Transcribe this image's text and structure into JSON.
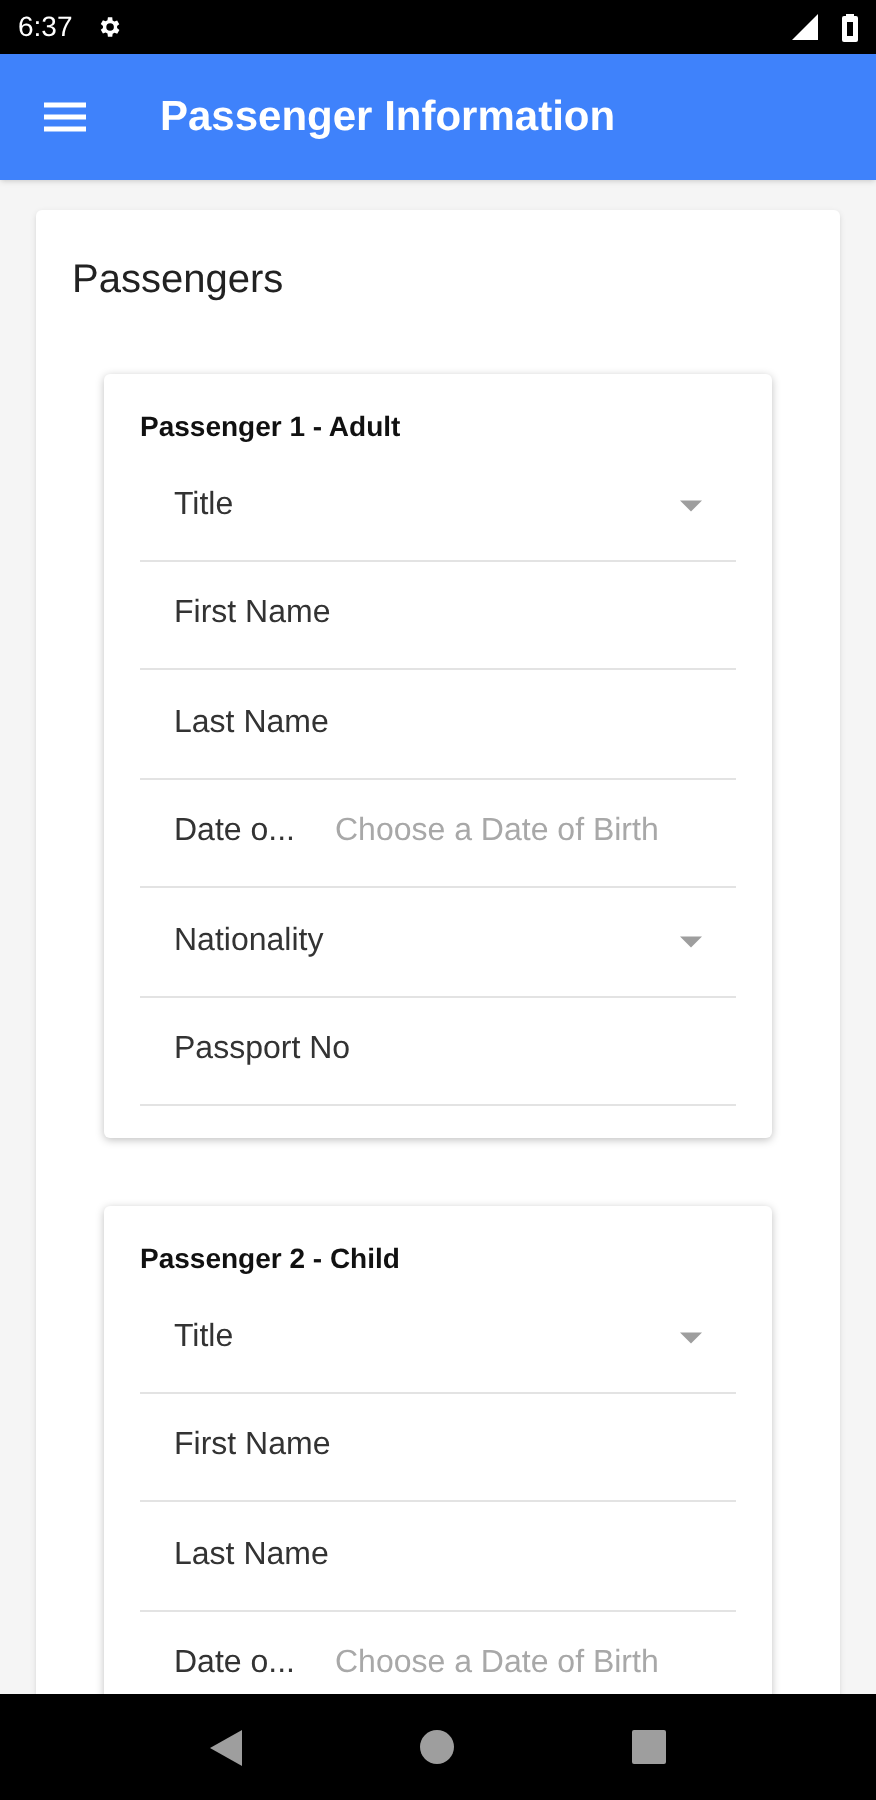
{
  "status_bar": {
    "time": "6:37"
  },
  "app_bar": {
    "title": "Passenger Information"
  },
  "section": {
    "title": "Passengers"
  },
  "passengers": [
    {
      "heading": "Passenger 1 - Adult",
      "fields": [
        {
          "kind": "select",
          "label": "Title"
        },
        {
          "kind": "text",
          "placeholder": "First Name"
        },
        {
          "kind": "text",
          "placeholder": "Last Name"
        },
        {
          "kind": "date",
          "label": "Date o...",
          "placeholder": "Choose a Date of Birth"
        },
        {
          "kind": "select",
          "label": "Nationality"
        },
        {
          "kind": "text",
          "placeholder": "Passport No"
        }
      ]
    },
    {
      "heading": "Passenger 2 - Child",
      "fields": [
        {
          "kind": "select",
          "label": "Title"
        },
        {
          "kind": "text",
          "placeholder": "First Name"
        },
        {
          "kind": "text",
          "placeholder": "Last Name"
        },
        {
          "kind": "date",
          "label": "Date o...",
          "placeholder": "Choose a Date of Birth"
        }
      ]
    }
  ]
}
